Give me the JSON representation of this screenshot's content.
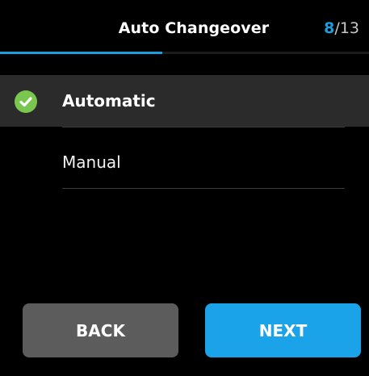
{
  "header": {
    "title": "Auto Changeover",
    "step_current": "8",
    "step_separator": "/",
    "step_total": "13",
    "progress": 0.44
  },
  "options": [
    {
      "label": "Automatic",
      "selected": true
    },
    {
      "label": "Manual",
      "selected": false
    }
  ],
  "buttons": {
    "back_label": "BACK",
    "next_label": "NEXT"
  },
  "colors": {
    "accent": "#1a9fe0",
    "check": "#7ac74f",
    "back_button": "#5c5c5c",
    "next_button": "#1aa3e8"
  },
  "icons": {
    "selected": "check-circle-icon"
  }
}
